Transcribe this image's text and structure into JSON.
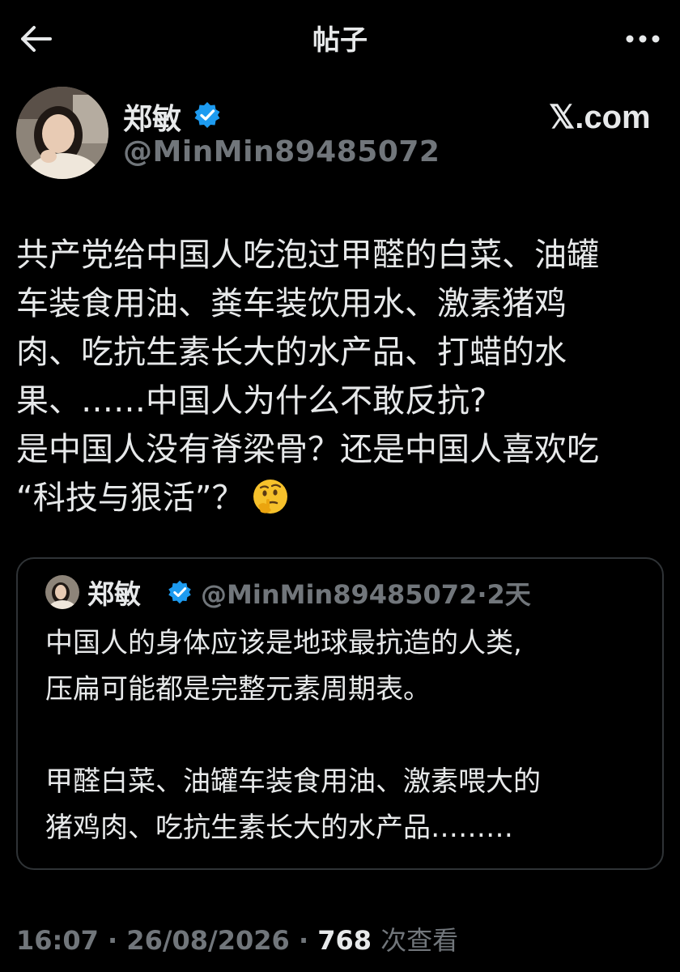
{
  "header": {
    "title": "帖子",
    "back_icon": "arrow-left-icon",
    "more_icon": "more-horizontal-icon"
  },
  "author": {
    "name": "郑敏",
    "handle": "@MinMin89485072",
    "verified": true,
    "avatar_icon": "avatar"
  },
  "watermark": "𝕏.com",
  "post": {
    "lines": [
      "共产党给中国人吃泡过甲醛的白菜、油罐",
      "车装食用油、粪车装饮用水、激素猪鸡",
      "肉、吃抗生素长大的水产品、打蜡的水",
      "果、……中国人为什么不敢反抗?",
      "是中国人没有脊梁骨？还是中国人喜欢吃",
      "“科技与狠活”？"
    ],
    "emoji": "thinking-face-emoji"
  },
  "quote": {
    "name": "郑敏",
    "handle": "@MinMin89485072",
    "separator": "·",
    "time": "2天",
    "lines": [
      "中国人的身体应该是地球最抗造的人类,",
      "压扁可能都是完整元素周期表。",
      "",
      "甲醛白菜、油罐车装食用油、激素喂大的",
      "猪鸡肉、吃抗生素长大的水产品………"
    ]
  },
  "footer": {
    "time": "16:07",
    "separator": "·",
    "date": "26/08/2026",
    "views_count": "768",
    "views_label": "次查看"
  },
  "colors": {
    "background": "#000000",
    "text": "#e7e9ea",
    "muted": "#71767b",
    "verified": "#1d9bf0",
    "border": "#2f3336"
  }
}
